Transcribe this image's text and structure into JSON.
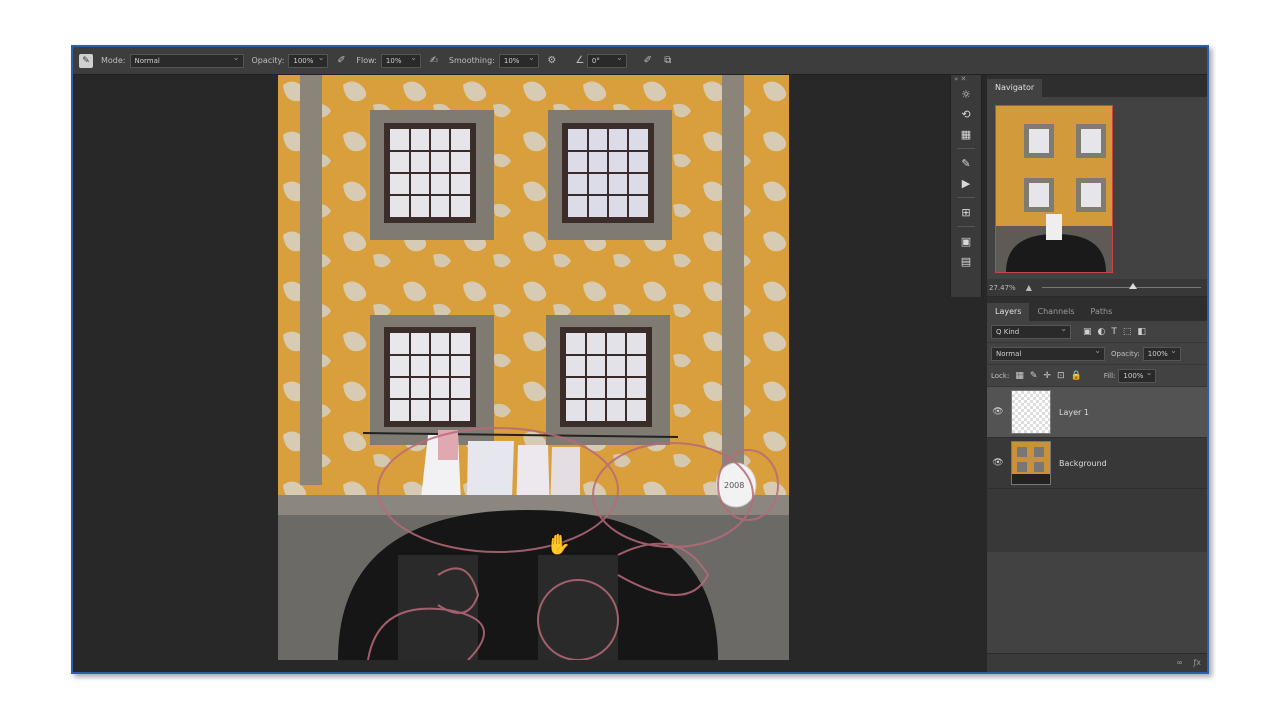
{
  "options_bar": {
    "mode_label": "Mode:",
    "mode_value": "Normal",
    "opacity_label": "Opacity:",
    "opacity_value": "100%",
    "flow_label": "Flow:",
    "flow_value": "10%",
    "smoothing_label": "Smoothing:",
    "smoothing_value": "10%",
    "angle_value": "0°"
  },
  "canvas": {
    "wall_color": "#d89f3c",
    "stroke_color": "#b86a78",
    "sign_text": "2008"
  },
  "navigator": {
    "tab_label": "Navigator",
    "zoom_value": "27.47%",
    "zoom_fraction": 0.55
  },
  "layers_panel": {
    "tabs": [
      "Layers",
      "Channels",
      "Paths"
    ],
    "filter_value": "Q Kind",
    "blend_mode": "Normal",
    "opacity_label": "Opacity:",
    "opacity_value": "100%",
    "lock_label": "Lock:",
    "fill_label": "Fill:",
    "fill_value": "100%",
    "layers": [
      {
        "name": "Layer 1",
        "selected": true
      },
      {
        "name": "Background",
        "selected": false
      }
    ]
  },
  "icons": {
    "brush_tool": "brush-icon",
    "eye": "eye-icon",
    "hand_cursor": "hand-icon"
  }
}
